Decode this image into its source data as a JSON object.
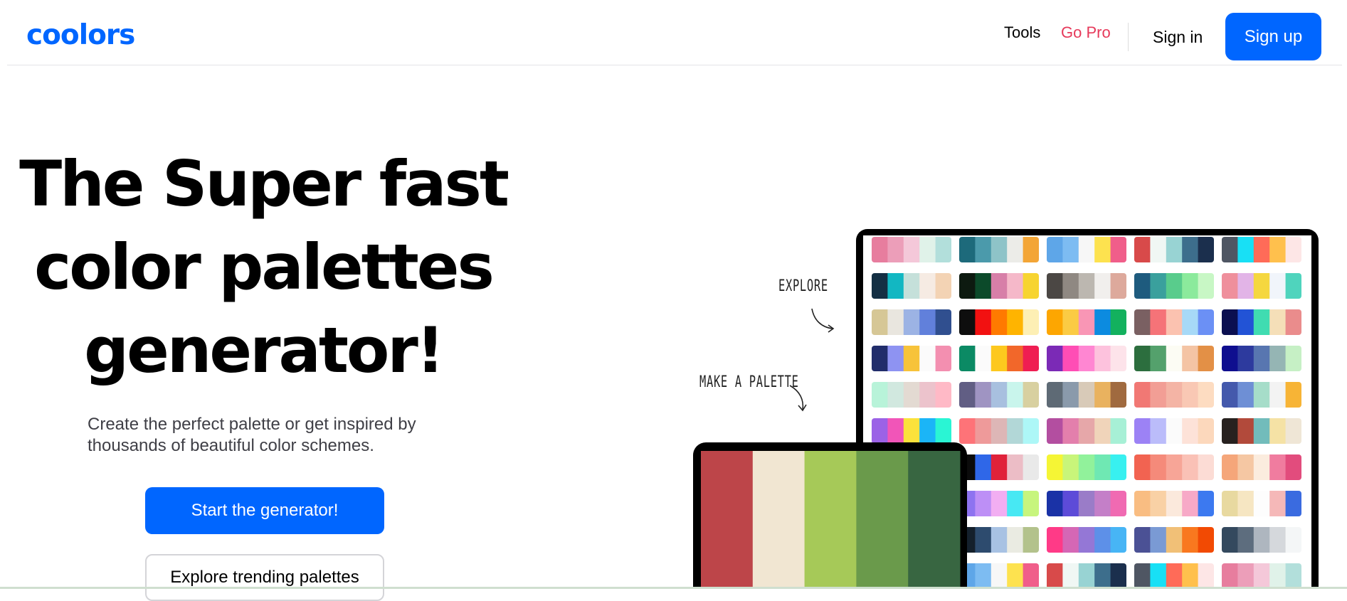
{
  "header": {
    "logo_text": "coolors",
    "nav": {
      "tools": "Tools",
      "go_pro": "Go Pro",
      "sign_in": "Sign in",
      "sign_up": "Sign up"
    }
  },
  "hero": {
    "title_lines": [
      "The Super fast",
      "color palettes",
      "generator!"
    ],
    "subtitle": "Create the perfect palette or get inspired by thousands of beautiful color schemes.",
    "cta_primary": "Start the generator!",
    "cta_secondary": "Explore trending palettes"
  },
  "illustration": {
    "annotation_explore": "EXPLORE",
    "annotation_make": "MAKE A PALETTE",
    "big_palette": [
      "#bd4549",
      "#f1e6d2",
      "#a6c958",
      "#6a9a4b",
      "#386641"
    ],
    "grid_rows": [
      [
        [
          "#e77d9e",
          "#ec9eb9",
          "#f4c8d9",
          "#e0f2e9",
          "#b2dfdb"
        ],
        [
          "#1d6a7b",
          "#4b9aab",
          "#8ec3c8",
          "#ecece8",
          "#f3a536"
        ],
        [
          "#5ea6e8",
          "#7dbcf2",
          "#f7f7f7",
          "#fde24f",
          "#f05e8a"
        ],
        [
          "#d84a4a",
          "#f0f7f4",
          "#98d3d3",
          "#3d6e8c",
          "#1b2f4d"
        ],
        [
          "#4f5663",
          "#18e0f5",
          "#ff6b58",
          "#ffc04d",
          "#fde6e6"
        ]
      ],
      [
        [
          "#142f43",
          "#12b7c2",
          "#c5e0da",
          "#f6ebe3",
          "#f3d3b4"
        ],
        [
          "#0d1a10",
          "#0c4a2a",
          "#d77fa8",
          "#f5b8c9",
          "#f7d431"
        ],
        [
          "#4b4744",
          "#8f8882",
          "#bcb7b0",
          "#f1efed",
          "#dda99c"
        ],
        [
          "#1e5b7e",
          "#3aa09d",
          "#59cc8c",
          "#8bea9c",
          "#c8f7c5"
        ],
        [
          "#ef8f9c",
          "#e2b4e7",
          "#f5d73f",
          "#f1f5fb",
          "#4fd4bd"
        ]
      ],
      [
        [
          "#d6c796",
          "#e9e6df",
          "#9cb3e4",
          "#6180db",
          "#304f8f"
        ],
        [
          "#0e0e0e",
          "#f21111",
          "#ff7a00",
          "#ffb400",
          "#fdefb4"
        ],
        [
          "#fda601",
          "#fbcb44",
          "#f996b5",
          "#0c8be0",
          "#13b15e"
        ],
        [
          "#7a6062",
          "#f57378",
          "#fbc2b0",
          "#a7d9f7",
          "#6b90f5"
        ],
        [
          "#0b0f50",
          "#2253d6",
          "#40dcb1",
          "#f5dfb8",
          "#ea8c8c"
        ]
      ],
      [
        [
          "#212d6b",
          "#8e93f2",
          "#f7c33a",
          "#fbfbfb",
          "#f38fb0"
        ],
        [
          "#0b8a64",
          "#fbfbfb",
          "#fdc81e",
          "#f2672a",
          "#ef1e52"
        ],
        [
          "#7b2ab6",
          "#ff4db5",
          "#ff86d2",
          "#fdc2dd",
          "#fde3ea"
        ],
        [
          "#2c6e3e",
          "#54a16c",
          "#fcfcf4",
          "#f4c4a4",
          "#e39046"
        ],
        [
          "#0f0e8f",
          "#2d3a9e",
          "#5876b0",
          "#95b5b4",
          "#c6f0c5"
        ]
      ],
      [
        [
          "#b8f3d9",
          "#d1e8df",
          "#e3dad2",
          "#ecc3cc",
          "#ffb9c6"
        ],
        [
          "#615e84",
          "#9f94c2",
          "#a8c0df",
          "#c9f5ec",
          "#d8d0a0"
        ],
        [
          "#5e6a75",
          "#8a9aab",
          "#d8cab8",
          "#e9b25f",
          "#a06a3f"
        ],
        [
          "#f17874",
          "#f29e95",
          "#f4b4a5",
          "#f9c8b4",
          "#fddcc1"
        ],
        [
          "#4459ac",
          "#6e8fd5",
          "#a6ddc9",
          "#f3f3f3",
          "#f7b436"
        ]
      ],
      [
        [
          "#9b62e6",
          "#f155b8",
          "#fbe23b",
          "#1bb5f7",
          "#2af5d4"
        ],
        [
          "#fe7378",
          "#ee9a9a",
          "#ddb6b6",
          "#b2d7d7",
          "#adf7f7"
        ],
        [
          "#b34ea0",
          "#e37fac",
          "#e6a7a9",
          "#f0d4ba",
          "#a7f0d6"
        ],
        [
          "#9c82f5",
          "#bbbcfa",
          "#fbfbfb",
          "#fde2d8",
          "#fcd8bc"
        ],
        [
          "#27211f",
          "#b24a3b",
          "#72bcbb",
          "#f5e2a5",
          "#efe6d6"
        ]
      ],
      [
        [
          "#a2cfd3",
          "#f7a22b",
          "#fdc23f",
          "#588a3b",
          "#0e4e17"
        ],
        [
          "#0b0b0b",
          "#2f67e8",
          "#e0223a",
          "#ecbdc6",
          "#e9e9e9"
        ],
        [
          "#f5f535",
          "#c8f57a",
          "#91f29b",
          "#6fe8b3",
          "#38f0f0"
        ],
        [
          "#f26351",
          "#f58a7a",
          "#f7a597",
          "#fac1b6",
          "#fcdcd5"
        ],
        [
          "#f5a67a",
          "#f5c7a3",
          "#fbecde",
          "#f07c9f",
          "#e24c7d"
        ]
      ],
      [
        [
          "#9a7c3a",
          "#2aa1e6",
          "#61bde9",
          "#f6e74d",
          "#1c2d59"
        ],
        [
          "#8e73f0",
          "#bd8ff6",
          "#f2aef2",
          "#47e8f3",
          "#c7f57d"
        ],
        [
          "#1a32a6",
          "#5d4bd8",
          "#9a7cc8",
          "#c47fc8",
          "#f06ab2"
        ],
        [
          "#f9bd82",
          "#f9d1a5",
          "#fbe9dc",
          "#f7a9c7",
          "#3c79f0"
        ],
        [
          "#e8d9a0",
          "#f6e6c2",
          "#fdfdfd",
          "#f5b8b8",
          "#3a6be0"
        ]
      ],
      [
        [
          "#2d2121",
          "#b39279",
          "#eac6a6",
          "#f8f3f9",
          "#baa3e3"
        ],
        [
          "#14202c",
          "#2d4b6e",
          "#a8c2e3",
          "#eaebe2",
          "#b3c28c"
        ],
        [
          "#ff3a87",
          "#d567b5",
          "#9477d6",
          "#5d90e8",
          "#47b5f5"
        ],
        [
          "#4b5195",
          "#7a9ad4",
          "#f1c077",
          "#f9781f",
          "#f24a03"
        ],
        [
          "#34495e",
          "#5d6d7e",
          "#aeb6bf",
          "#d5d8dc",
          "#f4f6f7"
        ]
      ],
      [
        [
          "#1f5f74",
          "#5ea2b6",
          "#8bc6c6",
          "#f2ecea",
          "#f5a239"
        ],
        [
          "#5ea6e8",
          "#7dbcf2",
          "#f7f7f7",
          "#fde24f",
          "#f05e8a"
        ],
        [
          "#d84a4a",
          "#f0f7f4",
          "#98d3d3",
          "#3d6e8c",
          "#1b2f4d"
        ],
        [
          "#4f5663",
          "#18e0f5",
          "#ff6b58",
          "#ffc04d",
          "#fde6e6"
        ],
        [
          "#e77d9e",
          "#ec9eb9",
          "#f4c8d9",
          "#e0f2e9",
          "#b2dfdb"
        ]
      ]
    ]
  }
}
